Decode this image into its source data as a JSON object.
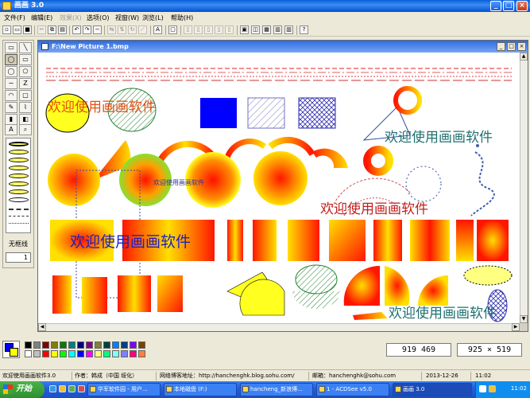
{
  "window": {
    "title": "画画 3.0"
  },
  "menu": [
    {
      "label": "文件(F)",
      "enabled": true
    },
    {
      "label": "编辑(E)",
      "enabled": true
    },
    {
      "label": "效果(X)",
      "enabled": false
    },
    {
      "label": "选项(O)",
      "enabled": true
    },
    {
      "label": "视窗(W)",
      "enabled": true
    },
    {
      "label": "浏览(L)",
      "enabled": true
    },
    {
      "label": "帮助(H)",
      "enabled": true
    }
  ],
  "document": {
    "title": "F:\\New Picture 1.bmp"
  },
  "toolbox": {
    "no_border_label": "无框线",
    "line_width": "1"
  },
  "canvas": {
    "text_samples": [
      "欢迎使用画画软件",
      "欢迎使用画画软件",
      "欢迎使用画画软件",
      "欢迎使用画画软件",
      "欢迎使用画画软件",
      "欢迎使用画画软件"
    ]
  },
  "readouts": {
    "cursor": "919 469",
    "size": "925 × 519"
  },
  "palette": {
    "colors": [
      "#000000",
      "#808080",
      "#800000",
      "#808000",
      "#008000",
      "#008080",
      "#000080",
      "#800080",
      "#808040",
      "#004040",
      "#0080ff",
      "#004080",
      "#8000ff",
      "#804000",
      "#ffffff",
      "#c0c0c0",
      "#ff0000",
      "#ffff00",
      "#00ff00",
      "#00ffff",
      "#0000ff",
      "#ff00ff",
      "#ffff80",
      "#00ff80",
      "#80ffff",
      "#8080ff",
      "#ff0080",
      "#ff8040"
    ],
    "current_fg": "#0000ff",
    "current_bg": "#ffff00"
  },
  "status": {
    "app": "欢迎使用画画软件3.0",
    "author": "作者：韩成（中国 绥化）",
    "blog": "网络博客地址：http://hanchenghk.blog.sohu.com/",
    "email": "邮箱：hanchenghk@sohu.com",
    "date": "2013-12-26",
    "time": "11:02"
  },
  "taskbar": {
    "start": "开始",
    "tasks": [
      "华军软件园 - 用户...",
      "本地磁盘 (F:)",
      "hancheng_新浪博...",
      "1 - ACDSee v5.0",
      "画画 3.0"
    ],
    "clock": "11:02"
  }
}
